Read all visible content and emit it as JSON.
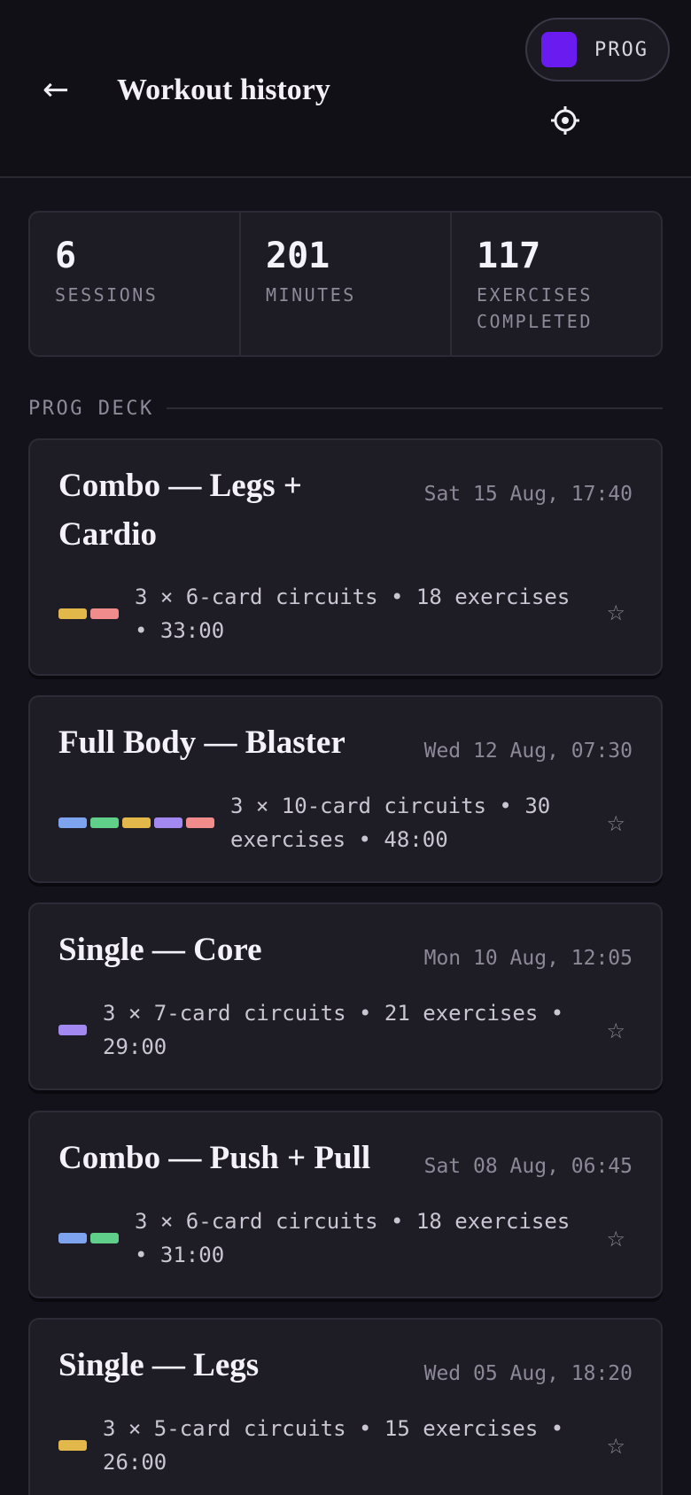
{
  "header": {
    "back_icon": "←",
    "title": "Workout history",
    "deck_label": "PROG",
    "deck_color": "#6a1cf0"
  },
  "stats": [
    {
      "value": "6",
      "label": "SESSIONS"
    },
    {
      "value": "201",
      "label": "MINUTES"
    },
    {
      "value": "117",
      "label": "EXERCISES COMPLETED"
    }
  ],
  "section": {
    "title": "PROG DECK"
  },
  "colors": {
    "legs": "#e3b84b",
    "cardio": "#f08c8c",
    "push": "#7ea4f0",
    "pull": "#5fcf8a",
    "core": "#a488f2"
  },
  "sessions": [
    {
      "title": "Combo — Legs + Cardio",
      "date": "Sat 15 Aug, 17:40",
      "meta": "3 × 6-card circuits • 18 exercises • 33:00",
      "swatches": [
        "#e3b84b",
        "#f08c8c"
      ],
      "star": "☆"
    },
    {
      "title": "Full Body — Blaster",
      "date": "Wed 12 Aug, 07:30",
      "meta": "3 × 10-card circuits • 30 exercises • 48:00",
      "swatches": [
        "#7ea4f0",
        "#5fcf8a",
        "#e3b84b",
        "#a488f2",
        "#f08c8c"
      ],
      "star": "☆"
    },
    {
      "title": "Single — Core",
      "date": "Mon 10 Aug, 12:05",
      "meta": "3 × 7-card circuits • 21 exercises • 29:00",
      "swatches": [
        "#a488f2"
      ],
      "star": "☆"
    },
    {
      "title": "Combo — Push + Pull",
      "date": "Sat 08 Aug, 06:45",
      "meta": "3 × 6-card circuits • 18 exercises • 31:00",
      "swatches": [
        "#7ea4f0",
        "#5fcf8a"
      ],
      "star": "☆"
    },
    {
      "title": "Single — Legs",
      "date": "Wed 05 Aug, 18:20",
      "meta": "3 × 5-card circuits • 15 exercises • 26:00",
      "swatches": [
        "#e3b84b"
      ],
      "star": "☆"
    }
  ]
}
